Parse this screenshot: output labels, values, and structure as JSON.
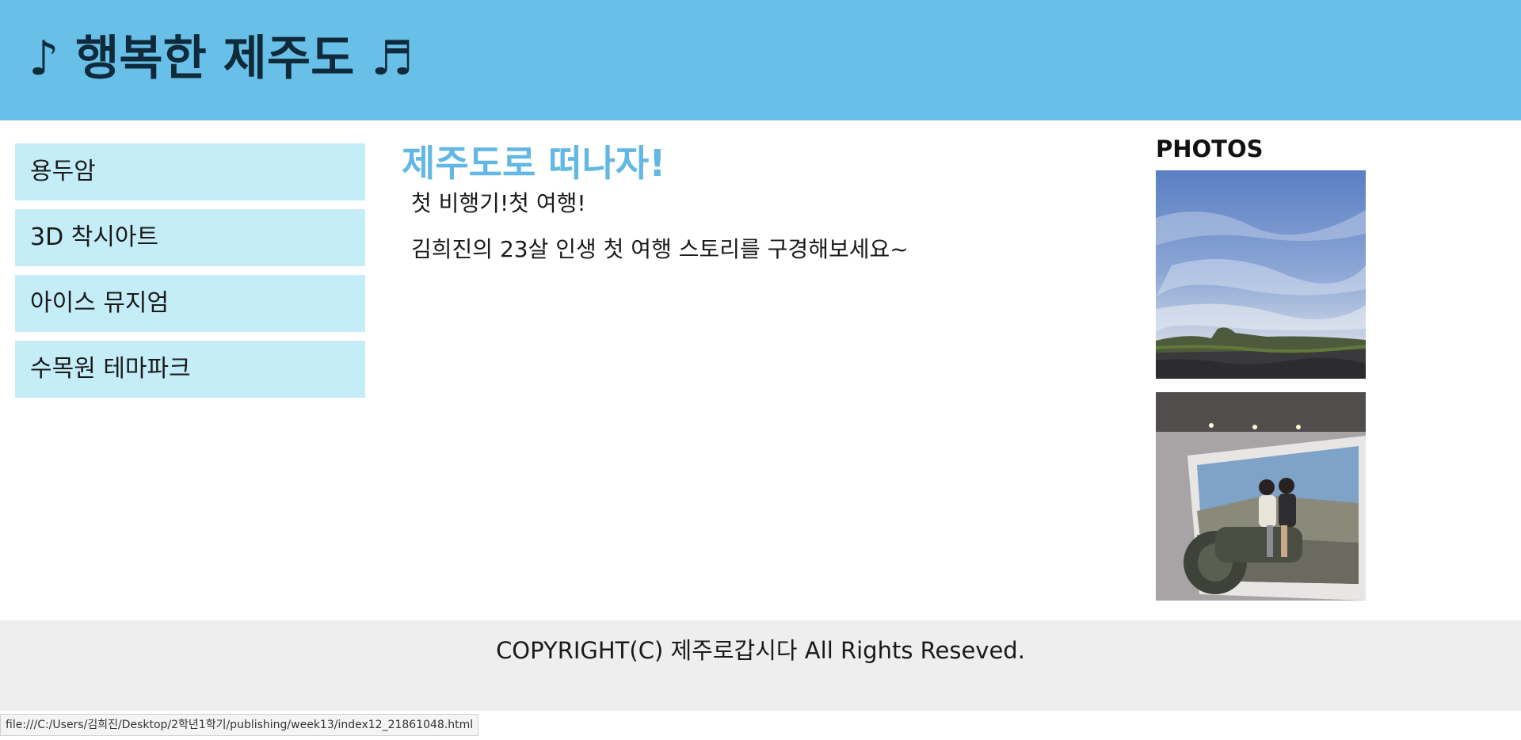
{
  "header": {
    "title": "♪ 행복한 제주도 ♬"
  },
  "nav": {
    "items": [
      {
        "label": "용두암"
      },
      {
        "label": "3D 착시아트"
      },
      {
        "label": "아이스 뮤지엄"
      },
      {
        "label": "수목원 테마파크"
      }
    ]
  },
  "main": {
    "title": "제주도로 떠나자!",
    "paragraphs": [
      "첫 비행기!첫 여행!",
      "김희진의 23살 인생 첫 여행 스토리를 구경해보세요~"
    ]
  },
  "aside": {
    "title": "PHOTOS",
    "photos": [
      {
        "subject": "sky-over-stone-wall-field"
      },
      {
        "subject": "3d-trick-art-motorcycle"
      }
    ]
  },
  "footer": {
    "copyright": "COPYRIGHT(C) 제주로갑시다 All Rights Reseved."
  },
  "status_bar": {
    "url": "file:///C:/Users/김희진/Desktop/2학년1학기/publishing/week13/index12_21861048.html"
  },
  "colors": {
    "header_bg": "#68c0e8",
    "nav_item_bg": "#c5edf8",
    "main_title": "#62b8e2",
    "footer_bg": "#eeeeee"
  }
}
